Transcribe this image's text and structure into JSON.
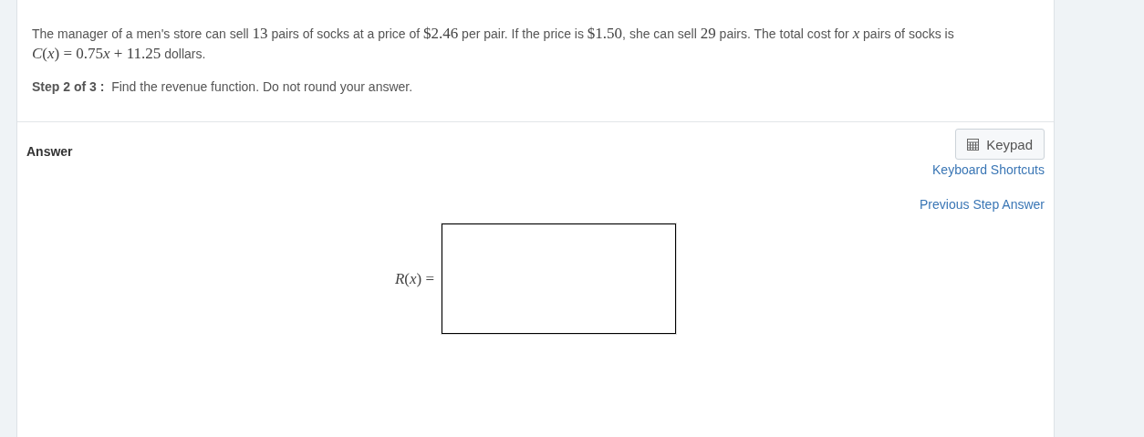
{
  "question": {
    "segments": [
      {
        "kind": "text",
        "text": "The manager of a men's store can sell "
      },
      {
        "kind": "math",
        "text": "13"
      },
      {
        "kind": "text",
        "text": " pairs of socks at a price of "
      },
      {
        "kind": "math",
        "text": "$2.46"
      },
      {
        "kind": "text",
        "text": " per pair.  If the price is "
      },
      {
        "kind": "math",
        "text": "$1.50"
      },
      {
        "kind": "text",
        "text": ", she can sell "
      },
      {
        "kind": "math",
        "text": "29"
      },
      {
        "kind": "text",
        "text": " pairs.  The total cost for "
      },
      {
        "kind": "math",
        "text": "*x*"
      },
      {
        "kind": "text",
        "text": " pairs of socks is "
      },
      {
        "kind": "math",
        "text": "*C*(*x*) = 0.75"
      },
      {
        "kind": "var",
        "text": "x"
      },
      {
        "kind": "math",
        "text": " + 11.25"
      },
      {
        "kind": "text",
        "text": " dollars."
      }
    ]
  },
  "step": {
    "label": "Step 2 of 3 :",
    "instruction": "Find the revenue function. Do not round your answer."
  },
  "answer": {
    "heading": "Answer",
    "keypad_button": "Keypad",
    "links": [
      "Keyboard Shortcuts",
      "Previous Step Answer"
    ],
    "equation_label": "*R*(*x*) ="
  }
}
